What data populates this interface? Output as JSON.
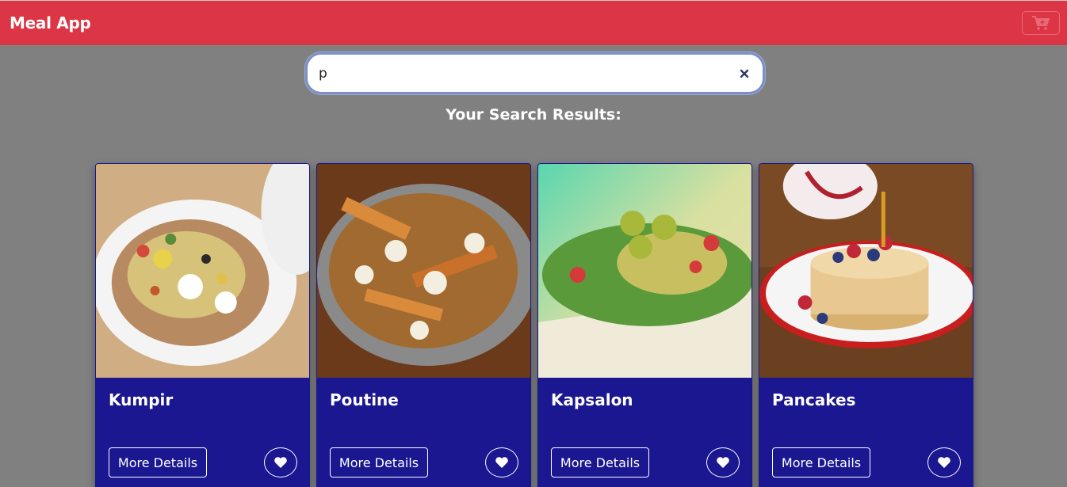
{
  "navbar": {
    "brand": "Meal App",
    "cart_icon": "cart-plus-icon",
    "background": "#dc3545"
  },
  "search": {
    "value": "p",
    "placeholder": "",
    "clear_icon": "close-icon"
  },
  "results_heading": "Your Search Results:",
  "cards": [
    {
      "title": "Kumpir",
      "image": "baked potato with toppings",
      "details_label": "More Details",
      "fav_icon": "heart-icon"
    },
    {
      "title": "Poutine",
      "image": "fries with gravy and cheese curds",
      "details_label": "More Details",
      "fav_icon": "heart-icon"
    },
    {
      "title": "Kapsalon",
      "image": "fries with salad and jalapenos",
      "details_label": "More Details",
      "fav_icon": "heart-icon"
    },
    {
      "title": "Pancakes",
      "image": "pancake stack with berries and syrup",
      "details_label": "More Details",
      "fav_icon": "heart-icon"
    }
  ],
  "colors": {
    "page_bg": "#808080",
    "card_bg": "#1a1791",
    "accent": "#dc3545"
  }
}
